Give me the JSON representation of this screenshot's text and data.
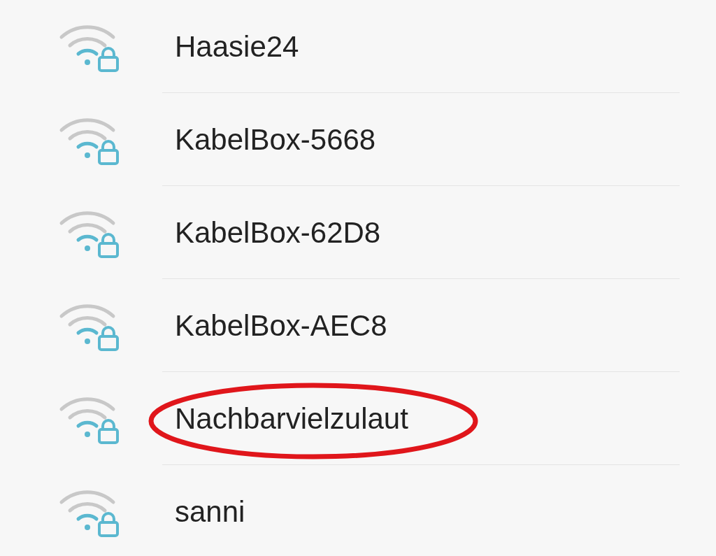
{
  "networks": [
    {
      "name": "Haasie24",
      "locked": true,
      "highlighted": false
    },
    {
      "name": "KabelBox-5668",
      "locked": true,
      "highlighted": false
    },
    {
      "name": "KabelBox-62D8",
      "locked": true,
      "highlighted": false
    },
    {
      "name": "KabelBox-AEC8",
      "locked": true,
      "highlighted": false
    },
    {
      "name": "Nachbarvielzulaut",
      "locked": true,
      "highlighted": true
    },
    {
      "name": "sanni",
      "locked": true,
      "highlighted": false
    }
  ]
}
